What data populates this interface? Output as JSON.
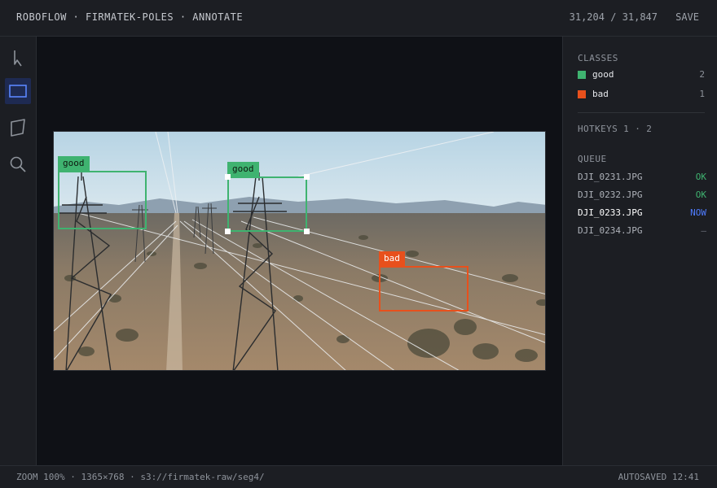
{
  "header": {
    "breadcrumb": "ROBOFLOW · FIRMATEK-POLES · ANNOTATE",
    "counter": "31,204 / 31,847",
    "save_label": "SAVE"
  },
  "toolbar": {
    "tools": [
      {
        "name": "pointer",
        "icon": "pointer-icon",
        "active": false
      },
      {
        "name": "box",
        "icon": "bounding-box-icon",
        "active": true
      },
      {
        "name": "polygon",
        "icon": "polygon-icon",
        "active": false
      },
      {
        "name": "zoom",
        "icon": "search-icon",
        "active": false
      }
    ]
  },
  "canvas": {
    "annotations": [
      {
        "label": "good",
        "class": "good"
      },
      {
        "label": "good",
        "class": "good",
        "selected": true
      },
      {
        "label": "bad",
        "class": "bad"
      }
    ]
  },
  "panel": {
    "classes_title": "CLASSES",
    "classes": [
      {
        "name": "good",
        "count": "2",
        "color": "#3fb370"
      },
      {
        "name": "bad",
        "count": "1",
        "color": "#e8501c"
      }
    ],
    "hotkeys": "HOTKEYS  1 · 2",
    "queue_title": "QUEUE",
    "queue": [
      {
        "file": "DJI_0231.JPG",
        "status": "OK",
        "color": "#3fb370"
      },
      {
        "file": "DJI_0232.JPG",
        "status": "OK",
        "color": "#3fb370"
      },
      {
        "file": "DJI_0233.JPG",
        "status": "NOW",
        "color": "#4f7cff"
      },
      {
        "file": "DJI_0234.JPG",
        "status": "—",
        "color": "#6b7078"
      }
    ]
  },
  "status": {
    "left": "ZOOM 100% · 1365×768 · s3://firmatek-raw/seg4/",
    "right": "AUTOSAVED 12:41"
  },
  "colors": {
    "accent": "#4f7cff",
    "good": "#3fb370",
    "bad": "#e8501c"
  }
}
